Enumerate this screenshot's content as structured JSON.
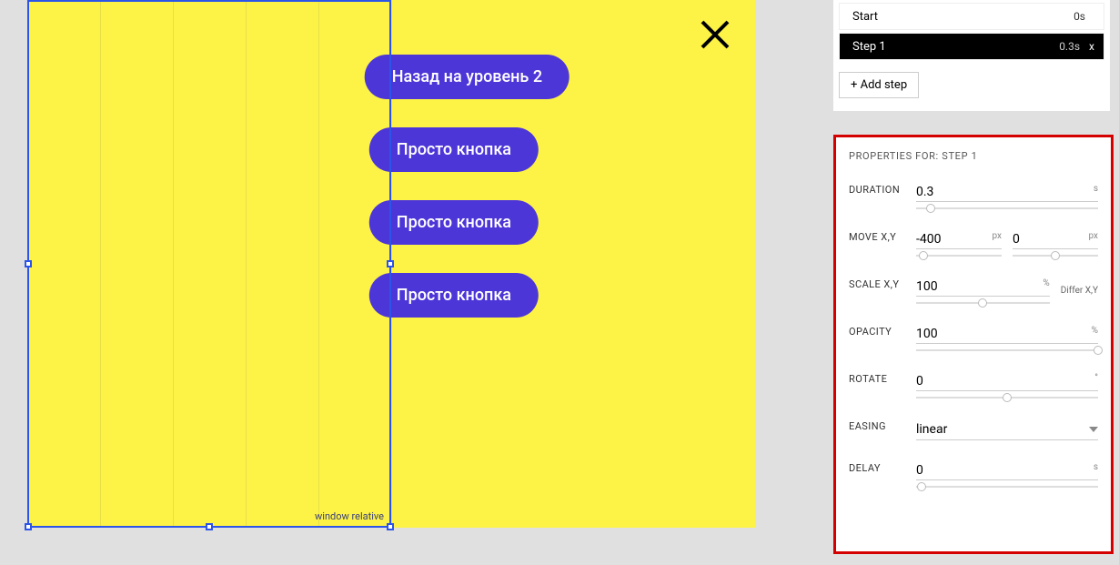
{
  "canvas": {
    "selection_tag": "window relative",
    "buttons": {
      "back": "Назад на уровень 2",
      "b1": "Просто кнопка",
      "b2": "Просто кнопка",
      "b3": "Просто кнопка"
    }
  },
  "steps": {
    "start": {
      "label": "Start",
      "time": "0s"
    },
    "step1": {
      "label": "Step 1",
      "time": "0.3s",
      "close": "x"
    },
    "add": "+ Add step"
  },
  "props": {
    "title": "PROPERTIES FOR: STEP 1",
    "duration": {
      "label": "DURATION",
      "value": "0.3",
      "unit": "s"
    },
    "move": {
      "label": "MOVE X,Y",
      "x": "-400",
      "y": "0",
      "unit": "px"
    },
    "scale": {
      "label": "SCALE X,Y",
      "value": "100",
      "unit": "%",
      "differ": "Differ X,Y"
    },
    "opacity": {
      "label": "OPACITY",
      "value": "100",
      "unit": "%"
    },
    "rotate": {
      "label": "ROTATE",
      "value": "0",
      "unit": "°"
    },
    "easing": {
      "label": "EASING",
      "value": "linear"
    },
    "delay": {
      "label": "DELAY",
      "value": "0",
      "unit": "s"
    }
  }
}
